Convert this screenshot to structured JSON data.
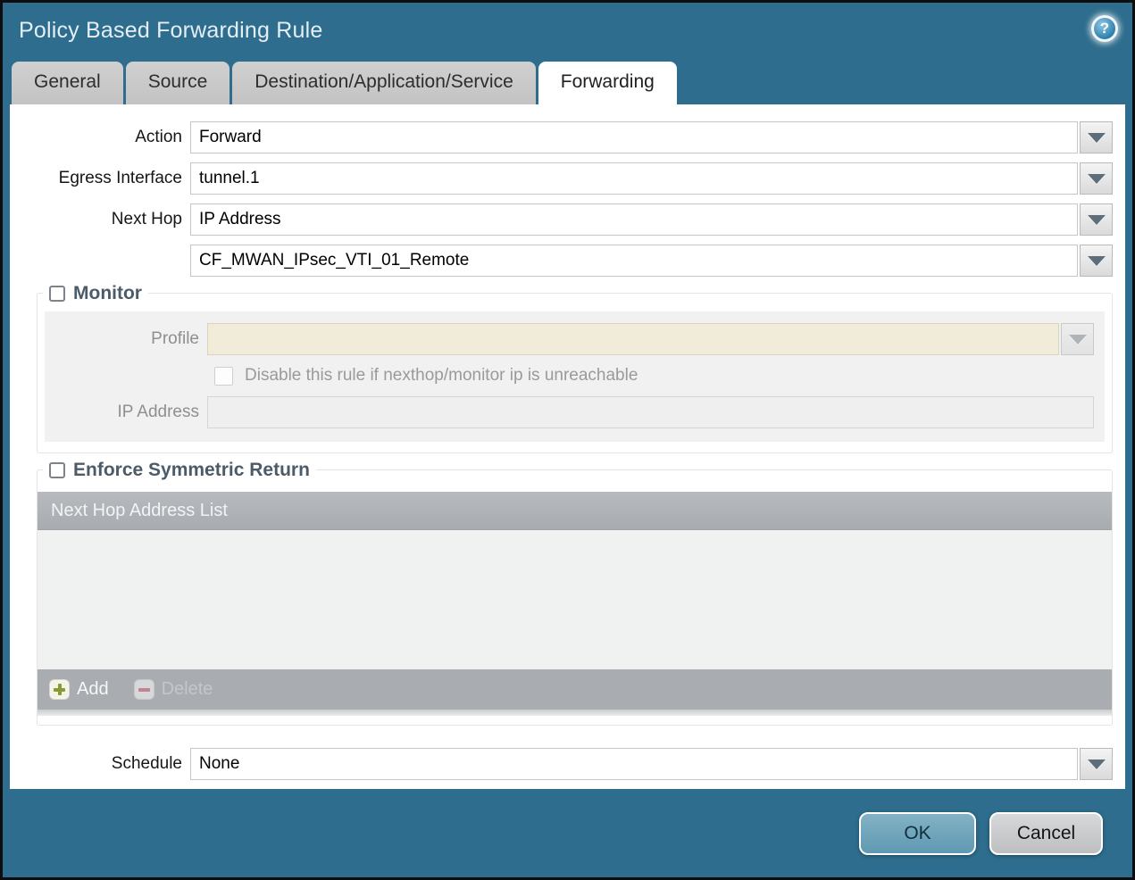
{
  "window": {
    "title": "Policy Based Forwarding Rule"
  },
  "help": {
    "glyph": "?"
  },
  "tabs": [
    {
      "label": "General",
      "active": false
    },
    {
      "label": "Source",
      "active": false
    },
    {
      "label": "Destination/Application/Service",
      "active": false
    },
    {
      "label": "Forwarding",
      "active": true
    }
  ],
  "form": {
    "action_label": "Action",
    "action_value": "Forward",
    "egress_label": "Egress Interface",
    "egress_value": "tunnel.1",
    "next_hop_label": "Next Hop",
    "next_hop_value": "IP Address",
    "next_hop_address_value": "CF_MWAN_IPsec_VTI_01_Remote",
    "schedule_label": "Schedule",
    "schedule_value": "None"
  },
  "monitor": {
    "title": "Monitor",
    "checked": false,
    "profile_label": "Profile",
    "profile_value": "",
    "disable_label": "Disable this rule if nexthop/monitor ip is unreachable",
    "disable_checked": false,
    "ip_label": "IP Address",
    "ip_value": ""
  },
  "symmetric": {
    "title": "Enforce Symmetric Return",
    "checked": false,
    "table_header": "Next Hop Address List",
    "rows": [],
    "add_label": "Add",
    "delete_label": "Delete"
  },
  "footer": {
    "ok": "OK",
    "cancel": "Cancel"
  },
  "colors": {
    "titlebar": "#2e6d8d",
    "tab_inactive": "#c9c9c9",
    "ok_button": "#6ba3b9",
    "cancel_button": "#c7c9cb",
    "disabled_field": "#f1ecd9",
    "table_header": "#aeb2b6",
    "table_footer": "#a9adb1",
    "add_plus": "#8a9a33",
    "delete_minus": "#c4828e",
    "section_title": "#4c5b68"
  }
}
